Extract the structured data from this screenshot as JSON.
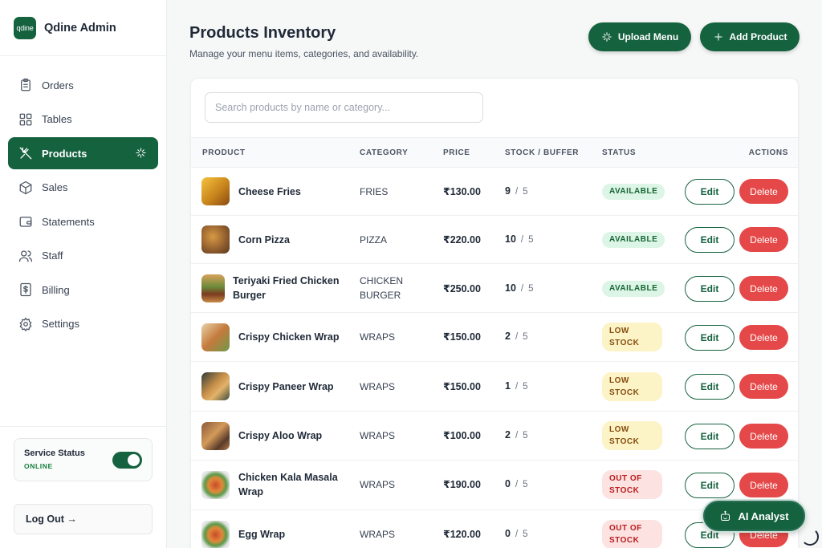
{
  "brand": {
    "logo_text": "qdine",
    "name": "Qdine Admin"
  },
  "nav": [
    {
      "label": "Orders",
      "icon": "clipboard-icon"
    },
    {
      "label": "Tables",
      "icon": "grid-icon"
    },
    {
      "label": "Products",
      "icon": "utensils-icon",
      "active": true
    },
    {
      "label": "Sales",
      "icon": "box-icon"
    },
    {
      "label": "Statements",
      "icon": "wallet-icon"
    },
    {
      "label": "Staff",
      "icon": "users-icon"
    },
    {
      "label": "Billing",
      "icon": "receipt-icon"
    },
    {
      "label": "Settings",
      "icon": "gear-icon"
    }
  ],
  "service": {
    "title": "Service Status",
    "status": "ONLINE",
    "enabled": true
  },
  "logout_label": "Log Out →",
  "header": {
    "title": "Products Inventory",
    "subtitle": "Manage your menu items, categories, and availability.",
    "upload_label": "Upload Menu",
    "add_label": "Add Product"
  },
  "search": {
    "placeholder": "Search products by name or category...",
    "value": ""
  },
  "table": {
    "columns": [
      "PRODUCT",
      "CATEGORY",
      "PRICE",
      "STOCK / BUFFER",
      "STATUS",
      "ACTIONS"
    ],
    "rows": [
      {
        "name": "Cheese Fries",
        "category": "FRIES",
        "price": "₹130.00",
        "stock": "9",
        "buffer": "5",
        "status": "AVAILABLE"
      },
      {
        "name": "Corn Pizza",
        "category": "PIZZA",
        "price": "₹220.00",
        "stock": "10",
        "buffer": "5",
        "status": "AVAILABLE"
      },
      {
        "name": "Teriyaki Fried Chicken Burger",
        "category": "CHICKEN BURGER",
        "price": "₹250.00",
        "stock": "10",
        "buffer": "5",
        "status": "AVAILABLE"
      },
      {
        "name": "Crispy Chicken Wrap",
        "category": "WRAPS",
        "price": "₹150.00",
        "stock": "2",
        "buffer": "5",
        "status": "LOW STOCK"
      },
      {
        "name": "Crispy Paneer Wrap",
        "category": "WRAPS",
        "price": "₹150.00",
        "stock": "1",
        "buffer": "5",
        "status": "LOW STOCK"
      },
      {
        "name": "Crispy Aloo Wrap",
        "category": "WRAPS",
        "price": "₹100.00",
        "stock": "2",
        "buffer": "5",
        "status": "LOW STOCK"
      },
      {
        "name": "Chicken Kala Masala Wrap",
        "category": "WRAPS",
        "price": "₹190.00",
        "stock": "0",
        "buffer": "5",
        "status": "OUT OF STOCK"
      },
      {
        "name": "Egg Wrap",
        "category": "WRAPS",
        "price": "₹120.00",
        "stock": "0",
        "buffer": "5",
        "status": "OUT OF STOCK"
      }
    ],
    "edit_label": "Edit",
    "delete_label": "Delete"
  },
  "ai_label": "AI Analyst",
  "colors": {
    "brand": "#15623f",
    "danger": "#e54848",
    "available_bg": "#dcf5e6",
    "low_bg": "#fcf3c7",
    "out_bg": "#fde2e2"
  }
}
